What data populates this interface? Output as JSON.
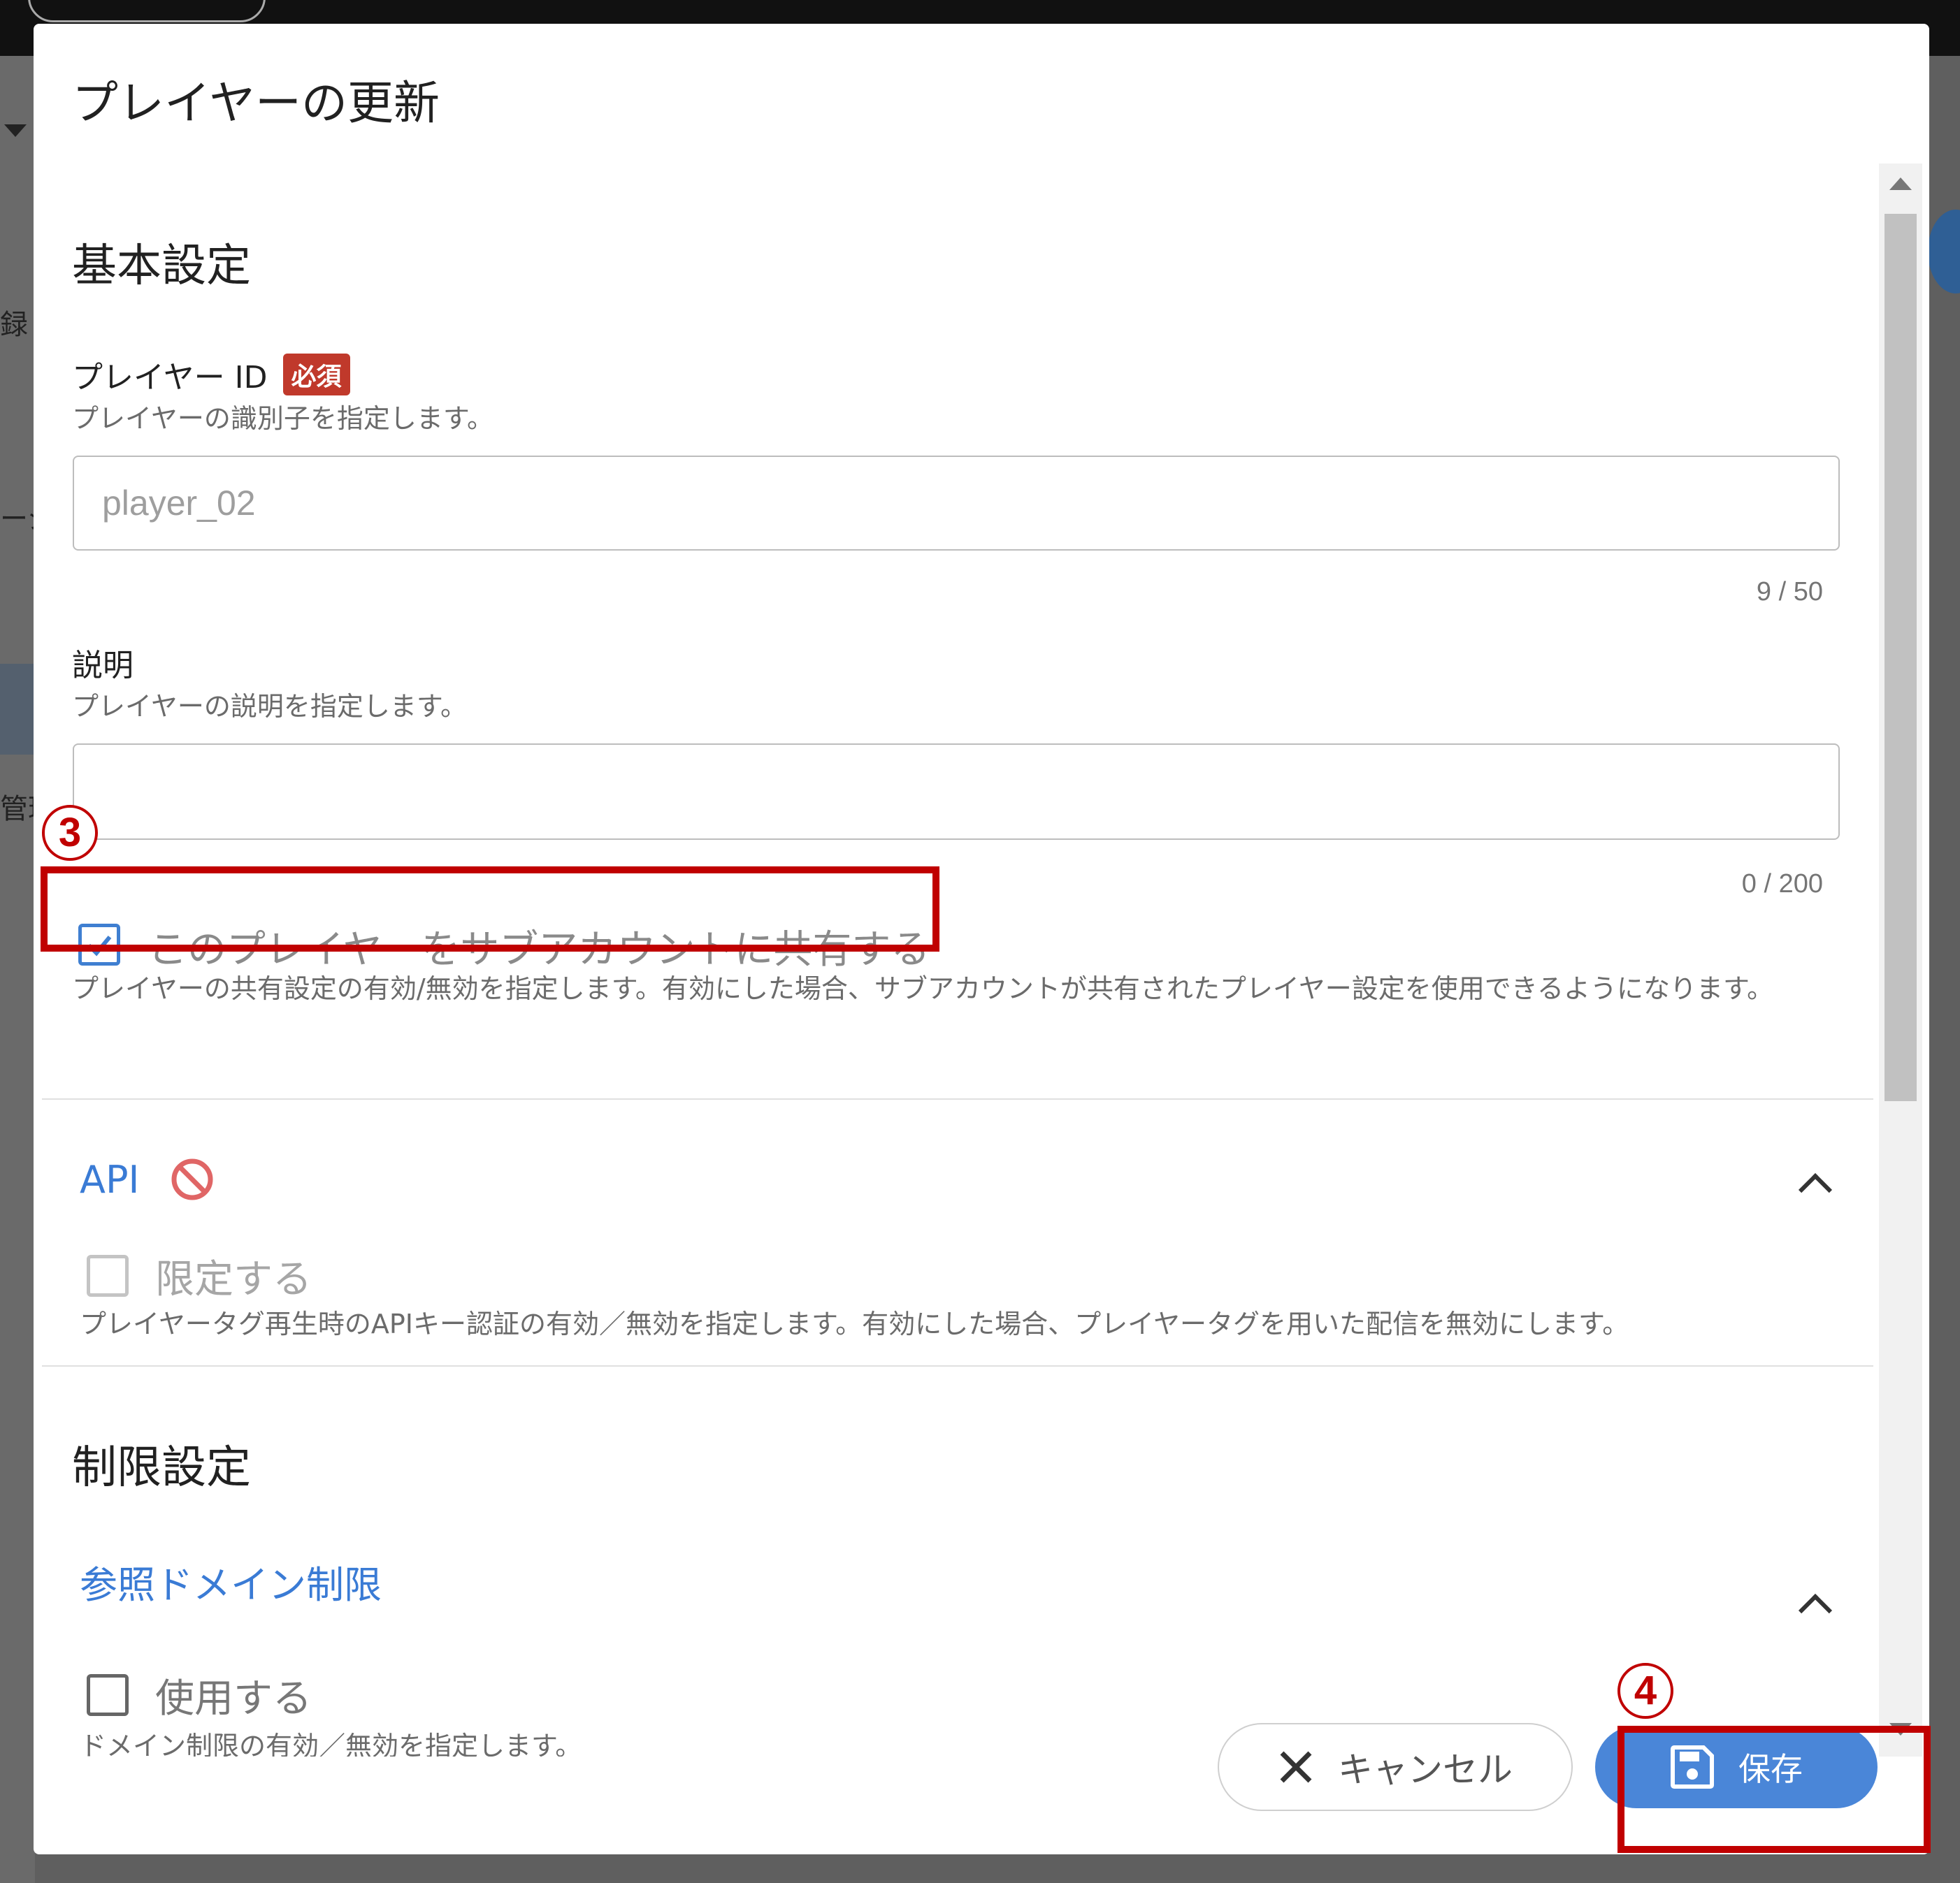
{
  "background": {
    "side_labels": [
      "録",
      "ージ",
      "管理"
    ]
  },
  "dialog": {
    "title": "プレイヤーの更新",
    "basic_settings": {
      "heading": "基本設定",
      "player_id": {
        "label": "プレイヤー ID",
        "required_badge": "必須",
        "help": "プレイヤーの識別子を指定します。",
        "value": "player_02",
        "counter": "9 / 50"
      },
      "description": {
        "label": "説明",
        "help": "プレイヤーの説明を指定します。",
        "value": "",
        "counter": "0 / 200"
      },
      "share": {
        "label": "このプレイヤーをサブアカウントに共有する",
        "checked": true,
        "help": "プレイヤーの共有設定の有効/無効を指定します。有効にした場合、サブアカウントが共有されたプレイヤー設定を使用できるようになります。"
      }
    },
    "api_panel": {
      "title": "API",
      "restrict_label": "限定する",
      "restrict_checked": false,
      "help": "プレイヤータグ再生時のAPIキー認証の有効／無効を指定します。有効にした場合、プレイヤータグを用いた配信を無効にします。"
    },
    "limit_settings": {
      "heading": "制限設定",
      "domain_panel": {
        "title": "参照ドメイン制限",
        "use_label": "使用する",
        "use_checked": false,
        "help": "ドメイン制限の有効／無効を指定します。"
      }
    },
    "footer": {
      "cancel_label": "キャンセル",
      "save_label": "保存"
    }
  },
  "annotations": {
    "step3": "3",
    "step4": "4",
    "color": "#c00000"
  },
  "colors": {
    "accent": "#3a7bd5",
    "save_button": "#4a86d8",
    "required_badge": "#c0392b"
  }
}
